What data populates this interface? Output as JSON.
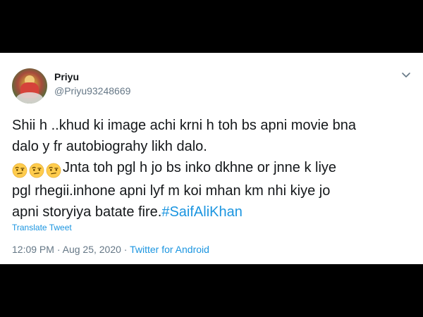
{
  "user": {
    "display_name": "Priyu",
    "handle": "@Priyu93248669",
    "avatar_icon": "profile-photo"
  },
  "tweet": {
    "line1": "Shii h ..khud ki image achi krni h toh bs apni movie bna",
    "line2": "dalo y fr autobiograhy likh dalo.",
    "line3_emoji_count": 3,
    "line3_text": "Jnta toh pgl h jo bs inko dkhne or jnne k liye",
    "line4": "pgl rhegii.inhone apni lyf m koi mhan km nhi kiye jo",
    "line5_text": "apni storyiya batate fire.",
    "hashtag": "#SaifAliKhan"
  },
  "translate_label": "Translate Tweet",
  "meta": {
    "time": "12:09 PM",
    "separator": " · ",
    "date": "Aug 25, 2020",
    "separator2": " · ",
    "source": "Twitter for Android"
  },
  "colors": {
    "link": "#1b95e0",
    "secondary": "#657786",
    "text": "#14171a",
    "background": "#000000"
  },
  "icons": {
    "more": "chevron-down-icon",
    "emoji": "face-with-raised-eyebrow-emoji"
  }
}
